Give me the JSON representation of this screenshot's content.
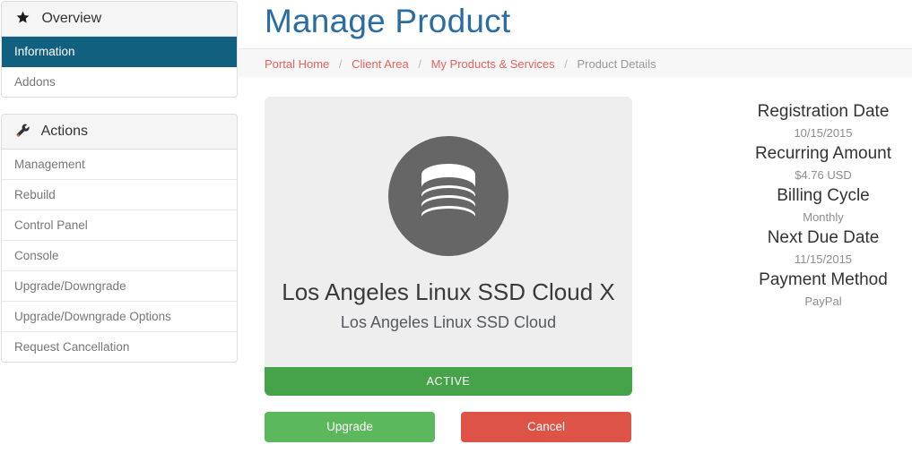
{
  "sidebar": {
    "panels": [
      {
        "heading": "Overview",
        "heading_icon": "star-icon",
        "items": [
          {
            "label": "Information",
            "active": true
          },
          {
            "label": "Addons",
            "active": false
          }
        ]
      },
      {
        "heading": "Actions",
        "heading_icon": "wrench-icon",
        "items": [
          {
            "label": "Management",
            "active": false
          },
          {
            "label": "Rebuild",
            "active": false
          },
          {
            "label": "Control Panel",
            "active": false
          },
          {
            "label": "Console",
            "active": false
          },
          {
            "label": "Upgrade/Downgrade",
            "active": false
          },
          {
            "label": "Upgrade/Downgrade Options",
            "active": false
          },
          {
            "label": "Request Cancellation",
            "active": false
          }
        ]
      }
    ]
  },
  "header": {
    "title": "Manage Product"
  },
  "breadcrumb": {
    "items": [
      {
        "label": "Portal Home",
        "current": false
      },
      {
        "label": "Client Area",
        "current": false
      },
      {
        "label": "My Products & Services",
        "current": false
      },
      {
        "label": "Product Details",
        "current": true
      }
    ],
    "separator": "/"
  },
  "product": {
    "icon": "database-icon",
    "name": "Los Angeles Linux SSD Cloud X",
    "description": "Los Angeles Linux SSD Cloud",
    "status": "ACTIVE",
    "status_color": "#46a34a"
  },
  "actions": {
    "upgrade_label": "Upgrade",
    "upgrade_color": "#5cb85c",
    "cancel_label": "Cancel",
    "cancel_color": "#dd5348"
  },
  "info": {
    "rows": [
      {
        "label": "Registration Date",
        "value": "10/15/2015"
      },
      {
        "label": "Recurring Amount",
        "value": "$4.76 USD"
      },
      {
        "label": "Billing Cycle",
        "value": "Monthly"
      },
      {
        "label": "Next Due Date",
        "value": "11/15/2015"
      },
      {
        "label": "Payment Method",
        "value": "PayPal"
      }
    ]
  },
  "theme": {
    "active_item": "#11607f",
    "title_blue": "#2b6da3",
    "breadcrumb_link": "#e8615b"
  }
}
